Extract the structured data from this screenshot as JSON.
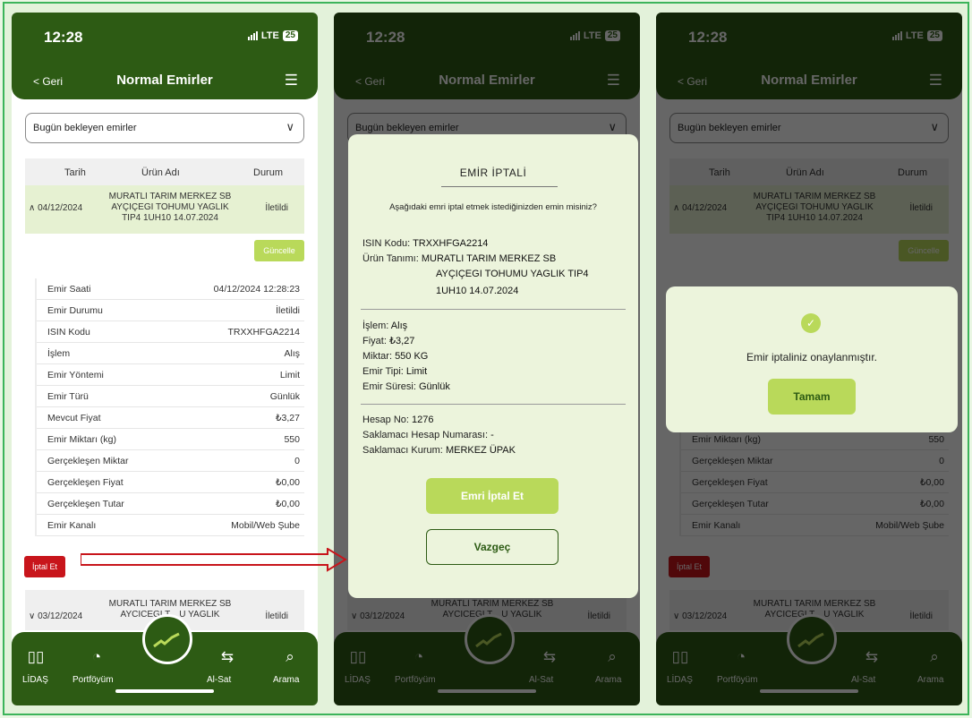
{
  "status_bar": {
    "time": "12:28",
    "network": "LTE",
    "battery": "25"
  },
  "nav": {
    "back_label": "< Geri",
    "title": "Normal Emirler",
    "menu_icon": "hamburger-icon"
  },
  "filter": {
    "selected": "Bugün bekleyen emirler"
  },
  "table": {
    "headers": [
      "Tarih",
      "Ürün Adı",
      "Durum"
    ],
    "rows": [
      {
        "date": "∧ 04/12/2024",
        "product": "MURATLI TARIM MERKEZ SB AYÇIÇEGI TOHUMU YAGLIK TIP4 1UH10 14.07.2024",
        "status": "İletildi"
      },
      {
        "date": "∨ 03/12/2024",
        "product": "MURATLI TARIM MERKEZ SB AYCICEGI T... U YAGLIK",
        "status": "İletildi"
      }
    ]
  },
  "update_button": "Güncelle",
  "details": [
    {
      "label": "Emir Saati",
      "value": "04/12/2024 12:28:23"
    },
    {
      "label": "Emir Durumu",
      "value": "İletildi"
    },
    {
      "label": "ISIN Kodu",
      "value": "TRXXHFGA2214"
    },
    {
      "label": "İşlem",
      "value": "Alış"
    },
    {
      "label": "Emir Yöntemi",
      "value": "Limit"
    },
    {
      "label": "Emir Türü",
      "value": "Günlük"
    },
    {
      "label": "Mevcut Fiyat",
      "value": "₺3,27"
    },
    {
      "label": "Emir Miktarı (kg)",
      "value": "550"
    },
    {
      "label": "Gerçekleşen Miktar",
      "value": "0"
    },
    {
      "label": "Gerçekleşen Fiyat",
      "value": "₺0,00"
    },
    {
      "label": "Gerçekleşen Tutar",
      "value": "₺0,00"
    },
    {
      "label": "Emir Kanalı",
      "value": "Mobil/Web Şube"
    }
  ],
  "cancel_button": "İptal Et",
  "tabs": [
    {
      "label": "LİDAŞ",
      "icon": "chart-icon"
    },
    {
      "label": "Portföyüm",
      "icon": "pie-icon"
    },
    {
      "label": "Al-Sat",
      "icon": "exchange-icon"
    },
    {
      "label": "Arama",
      "icon": "search-icon"
    }
  ],
  "cancel_dialog": {
    "title": "EMİR İPTALİ",
    "question": "Aşağıdaki emri iptal etmek istediğinizden emin misiniz?",
    "isin_label": "ISIN Kodu:",
    "isin_value": "TRXXHFGA2214",
    "product_label": "Ürün Tanımı:",
    "product_value_1": "MURATLI TARIM MERKEZ SB",
    "product_value_2": "AYÇIÇEGI TOHUMU YAGLIK  TIP4",
    "product_value_3": "1UH10 14.07.2024",
    "islem_label": "İşlem:",
    "islem_value": "Alış",
    "fiyat_label": "Fiyat:",
    "fiyat_value": "₺3,27",
    "miktar_label": "Miktar:",
    "miktar_value": "550 KG",
    "tip_label": "Emir Tipi:",
    "tip_value": "Limit",
    "sure_label": "Emir Süresi:",
    "sure_value": "Günlük",
    "hesap_label": "Hesap No:",
    "hesap_value": "1276",
    "saklamaci_hesap_label": "Saklamacı Hesap Numarası:",
    "saklamaci_hesap_value": "-",
    "saklamaci_kurum_label": "Saklamacı Kurum:",
    "saklamaci_kurum_value": "MERKEZ ÜPAK",
    "confirm_button": "Emri İptal Et",
    "dismiss_button": "Vazgeç"
  },
  "success_dialog": {
    "message": "Emir iptaliniz onaylanmıştır.",
    "ok_button": "Tamam"
  }
}
